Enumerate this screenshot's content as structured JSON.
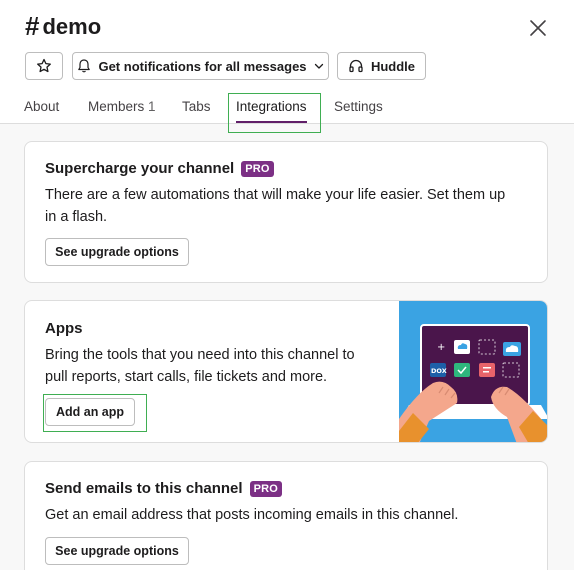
{
  "channel": {
    "hash": "#",
    "name": "demo"
  },
  "toolbar": {
    "notifications_label": "Get notifications for all messages",
    "huddle_label": "Huddle"
  },
  "tabs": [
    {
      "label": "About"
    },
    {
      "label": "Members",
      "count": "1"
    },
    {
      "label": "Tabs"
    },
    {
      "label": "Integrations",
      "active": true
    },
    {
      "label": "Settings"
    }
  ],
  "cards": {
    "supercharge": {
      "title": "Supercharge your channel",
      "badge": "PRO",
      "description_line1": "There are a few automations that will make your life easier. Set them up",
      "description_line2": "in a flash.",
      "button": "See upgrade options"
    },
    "apps": {
      "title": "Apps",
      "description_line1": "Bring the tools that you need into this channel to",
      "description_line2": "pull reports, start calls, file tickets and more.",
      "button": "Add an app",
      "illustration_text": "DOX"
    },
    "emails": {
      "title": "Send emails to this channel",
      "badge": "PRO",
      "description": "Get an email address that posts incoming emails in this channel.",
      "button": "See upgrade options"
    }
  },
  "colors": {
    "accent": "#611f69",
    "pro_badge": "#7c3085",
    "highlight": "#3fae52",
    "illustration_bg": "#3aa3e3"
  },
  "icons": [
    "star-icon",
    "bell-icon",
    "chevron-down-icon",
    "headphones-icon",
    "close-icon"
  ]
}
